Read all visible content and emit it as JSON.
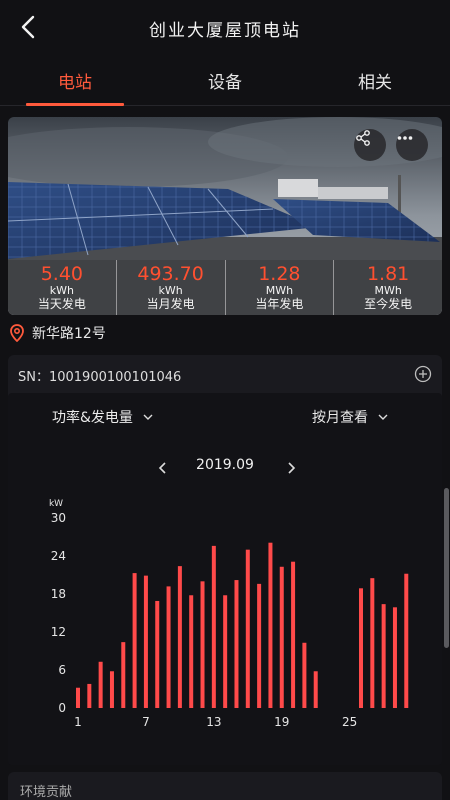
{
  "header": {
    "title": "创业大厦屋顶电站",
    "back_icon": "chevron-left-icon"
  },
  "tabs": [
    {
      "label": "电站",
      "active": true
    },
    {
      "label": "设备",
      "active": false
    },
    {
      "label": "相关",
      "active": false
    }
  ],
  "accent_color": "#ff5a3c",
  "hero": {
    "share_icon": "share-icon",
    "more_icon": "more-icon",
    "stats": [
      {
        "value": "5.40",
        "unit": "kWh",
        "label": "当天发电"
      },
      {
        "value": "493.70",
        "unit": "kWh",
        "label": "当月发电"
      },
      {
        "value": "1.28",
        "unit": "MWh",
        "label": "当年发电"
      },
      {
        "value": "1.81",
        "unit": "MWh",
        "label": "至今发电"
      }
    ]
  },
  "address": {
    "icon": "location-pin-icon",
    "text": "新华路12号"
  },
  "station_card": {
    "sn_label": "SN：1001900100101046",
    "add_icon": "plus-circle-icon",
    "metric_dropdown": "功率&发电量",
    "period_dropdown": "按月查看",
    "month": "2019.09"
  },
  "chart_data": {
    "type": "bar",
    "ylabel": "kW",
    "ylim": [
      0,
      30
    ],
    "yticks": [
      0,
      6,
      12,
      18,
      24,
      30
    ],
    "xticks": [
      1,
      7,
      13,
      19,
      25
    ],
    "bar_color": "#ff4a4a",
    "x": [
      1,
      2,
      3,
      4,
      5,
      6,
      7,
      8,
      9,
      10,
      11,
      12,
      13,
      14,
      15,
      16,
      17,
      18,
      19,
      20,
      21,
      22,
      23,
      24,
      25,
      26,
      27,
      28,
      29,
      30
    ],
    "values": [
      3.2,
      3.8,
      7.3,
      5.8,
      10.4,
      21.3,
      20.9,
      16.9,
      19.2,
      22.4,
      17.8,
      20.0,
      25.6,
      17.8,
      20.2,
      25.0,
      19.6,
      26.1,
      22.3,
      23.1,
      10.3,
      5.8,
      null,
      null,
      null,
      18.9,
      20.5,
      16.4,
      15.9,
      21.2
    ]
  },
  "env_card": {
    "title": "环境贡献"
  }
}
